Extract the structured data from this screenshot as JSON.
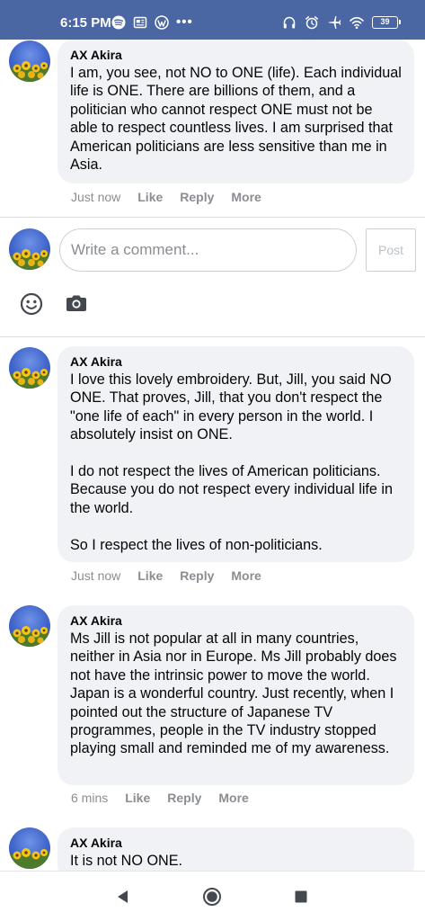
{
  "status_bar": {
    "time": "6:15 PM",
    "left_icons": [
      "spotify-icon",
      "news-icon",
      "wordpress-icon"
    ],
    "more_glyph": "•••",
    "right_icons": [
      "headphones-icon",
      "alarm-icon",
      "airplane-icon",
      "wifi-icon"
    ],
    "battery": "39",
    "background_color": "#4a66a3"
  },
  "comments": [
    {
      "author": "AX Akira",
      "text": "I am, you see, not NO to ONE (life). Each individual life is ONE. There are billions of them, and a politician who cannot respect ONE must not be able to respect countless lives. I am surprised that American politicians are less sensitive than me in Asia.",
      "time": "Just now",
      "actions": [
        "Like",
        "Reply",
        "More"
      ]
    },
    {
      "author": "AX Akira",
      "text": "I love this lovely embroidery. But, Jill, you said NO ONE. That proves, Jill, that you don't respect the \"one life of each\" in every person in the world. I absolutely insist on ONE.\n\nI do not respect the lives of American politicians. Because you do not respect every individual life in the world.\n\nSo I respect the lives of non-politicians.",
      "time": "Just now",
      "actions": [
        "Like",
        "Reply",
        "More"
      ]
    },
    {
      "author": "AX Akira",
      "text": "Ms Jill is not popular at all in many countries, neither in Asia nor in Europe. Ms Jill probably does not have the intrinsic power to move the world. Japan is a wonderful country. Just recently, when I pointed out the structure of Japanese TV programmes, people in the TV industry stopped playing small and reminded me of my awareness.",
      "time": "6 mins",
      "actions": [
        "Like",
        "Reply",
        "More"
      ]
    },
    {
      "author": "AX Akira",
      "text": "It is not NO ONE.",
      "time": "",
      "actions": []
    }
  ],
  "write_comment": {
    "placeholder": "Write a comment...",
    "post_label": "Post",
    "tools": [
      "emoji-icon",
      "camera-icon"
    ]
  },
  "nav_bar": {
    "buttons": [
      "back-button",
      "home-button",
      "recents-button"
    ]
  }
}
